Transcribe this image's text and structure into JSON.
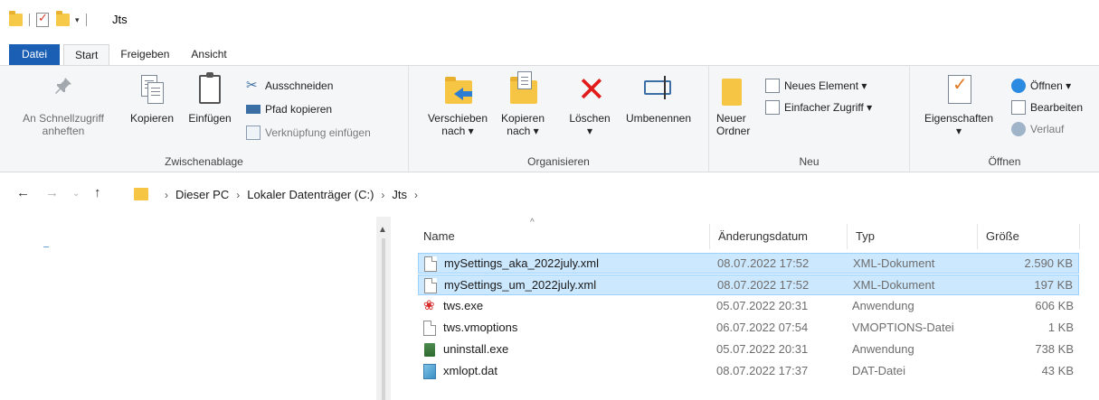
{
  "window": {
    "title": "Jts"
  },
  "tabs": [
    {
      "label": "Datei"
    },
    {
      "label": "Start"
    },
    {
      "label": "Freigeben"
    },
    {
      "label": "Ansicht"
    }
  ],
  "ribbon": {
    "clipboard": {
      "label": "Zwischenablage",
      "pin_line1": "An Schnellzugriff",
      "pin_line2": "anheften",
      "copy": "Kopieren",
      "paste": "Einfügen",
      "cut": "Ausschneiden",
      "copy_path": "Pfad kopieren",
      "paste_shortcut": "Verknüpfung einfügen"
    },
    "organize": {
      "label": "Organisieren",
      "move_line1": "Verschieben",
      "move_line2": "nach ▾",
      "copyto_line1": "Kopieren",
      "copyto_line2": "nach ▾",
      "delete": "Löschen",
      "delete_arrow": "▾",
      "rename": "Umbenennen"
    },
    "new": {
      "label": "Neu",
      "folder_line1": "Neuer",
      "folder_line2": "Ordner",
      "new_item": "Neues Element ▾",
      "easy_access": "Einfacher Zugriff ▾"
    },
    "open": {
      "label": "Öffnen",
      "properties": "Eigenschaften",
      "properties_arrow": "▾",
      "open": "Öffnen ▾",
      "edit": "Bearbeiten",
      "history": "Verlauf"
    }
  },
  "address": {
    "crumbs": [
      "Dieser PC",
      "Lokaler Datenträger (C:)",
      "Jts"
    ]
  },
  "filelist": {
    "columns": [
      "Name",
      "Änderungsdatum",
      "Typ",
      "Größe"
    ],
    "rows": [
      {
        "name": "mySettings_aka_2022july.xml",
        "date": "08.07.2022 17:52",
        "type": "XML-Dokument",
        "size": "2.590 KB",
        "icon": "document-icon",
        "selected": true
      },
      {
        "name": "mySettings_um_2022july.xml",
        "date": "08.07.2022 17:52",
        "type": "XML-Dokument",
        "size": "197 KB",
        "icon": "document-icon",
        "selected": true
      },
      {
        "name": "tws.exe",
        "date": "05.07.2022 20:31",
        "type": "Anwendung",
        "size": "606 KB",
        "icon": "java-icon",
        "selected": false
      },
      {
        "name": "tws.vmoptions",
        "date": "06.07.2022 07:54",
        "type": "VMOPTIONS-Datei",
        "size": "1 KB",
        "icon": "document-icon",
        "selected": false
      },
      {
        "name": "uninstall.exe",
        "date": "05.07.2022 20:31",
        "type": "Anwendung",
        "size": "738 KB",
        "icon": "uninstaller-icon",
        "selected": false
      },
      {
        "name": "xmlopt.dat",
        "date": "08.07.2022 17:37",
        "type": "DAT-Datei",
        "size": "43 KB",
        "icon": "data-file-icon",
        "selected": false
      }
    ]
  }
}
